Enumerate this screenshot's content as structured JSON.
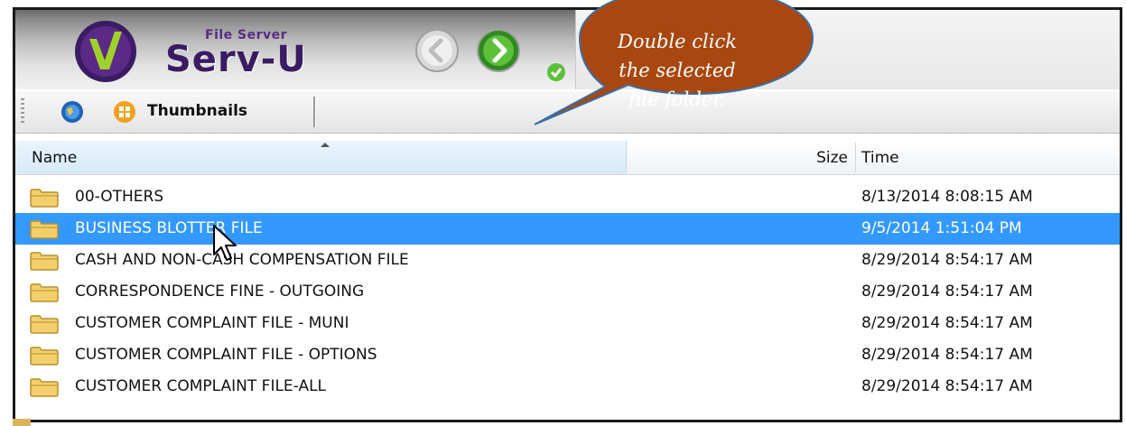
{
  "app": {
    "brand_small": "File Server",
    "brand_name": "Serv-U"
  },
  "toolbar": {
    "view_label": "Thumbnails"
  },
  "columns": {
    "name": "Name",
    "size": "Size",
    "time": "Time"
  },
  "files": [
    {
      "name": "00-OTHERS",
      "size": "",
      "time": "8/13/2014 8:08:15 AM",
      "selected": false
    },
    {
      "name": "BUSINESS BLOTTER FILE",
      "size": "",
      "time": "9/5/2014 1:51:04 PM",
      "selected": true
    },
    {
      "name": "CASH AND NON-CASH COMPENSATION FILE",
      "size": "",
      "time": "8/29/2014 8:54:17 AM",
      "selected": false
    },
    {
      "name": "CORRESPONDENCE FINE - OUTGOING",
      "size": "",
      "time": "8/29/2014 8:54:17 AM",
      "selected": false
    },
    {
      "name": "CUSTOMER COMPLAINT FILE - MUNI",
      "size": "",
      "time": "8/29/2014 8:54:17 AM",
      "selected": false
    },
    {
      "name": "CUSTOMER COMPLAINT FILE - OPTIONS",
      "size": "",
      "time": "8/29/2014 8:54:17 AM",
      "selected": false
    },
    {
      "name": "CUSTOMER COMPLAINT FILE-ALL",
      "size": "",
      "time": "8/29/2014 8:54:17 AM",
      "selected": false
    }
  ],
  "callout": {
    "line1": "Double click",
    "line2": "the selected",
    "line3": "file folder."
  },
  "icons": {
    "logo": "serv-u-logo-icon",
    "back": "back-arrow-icon",
    "forward": "forward-arrow-icon",
    "view1": "globe-icon",
    "view2": "thumbnails-icon",
    "folder": "folder-icon",
    "cursor": "mouse-cursor-icon"
  },
  "colors": {
    "selection": "#3399ff",
    "callout_fill": "#a8470f",
    "brand": "#3b1c63",
    "nav_green": "#3fa12a"
  }
}
